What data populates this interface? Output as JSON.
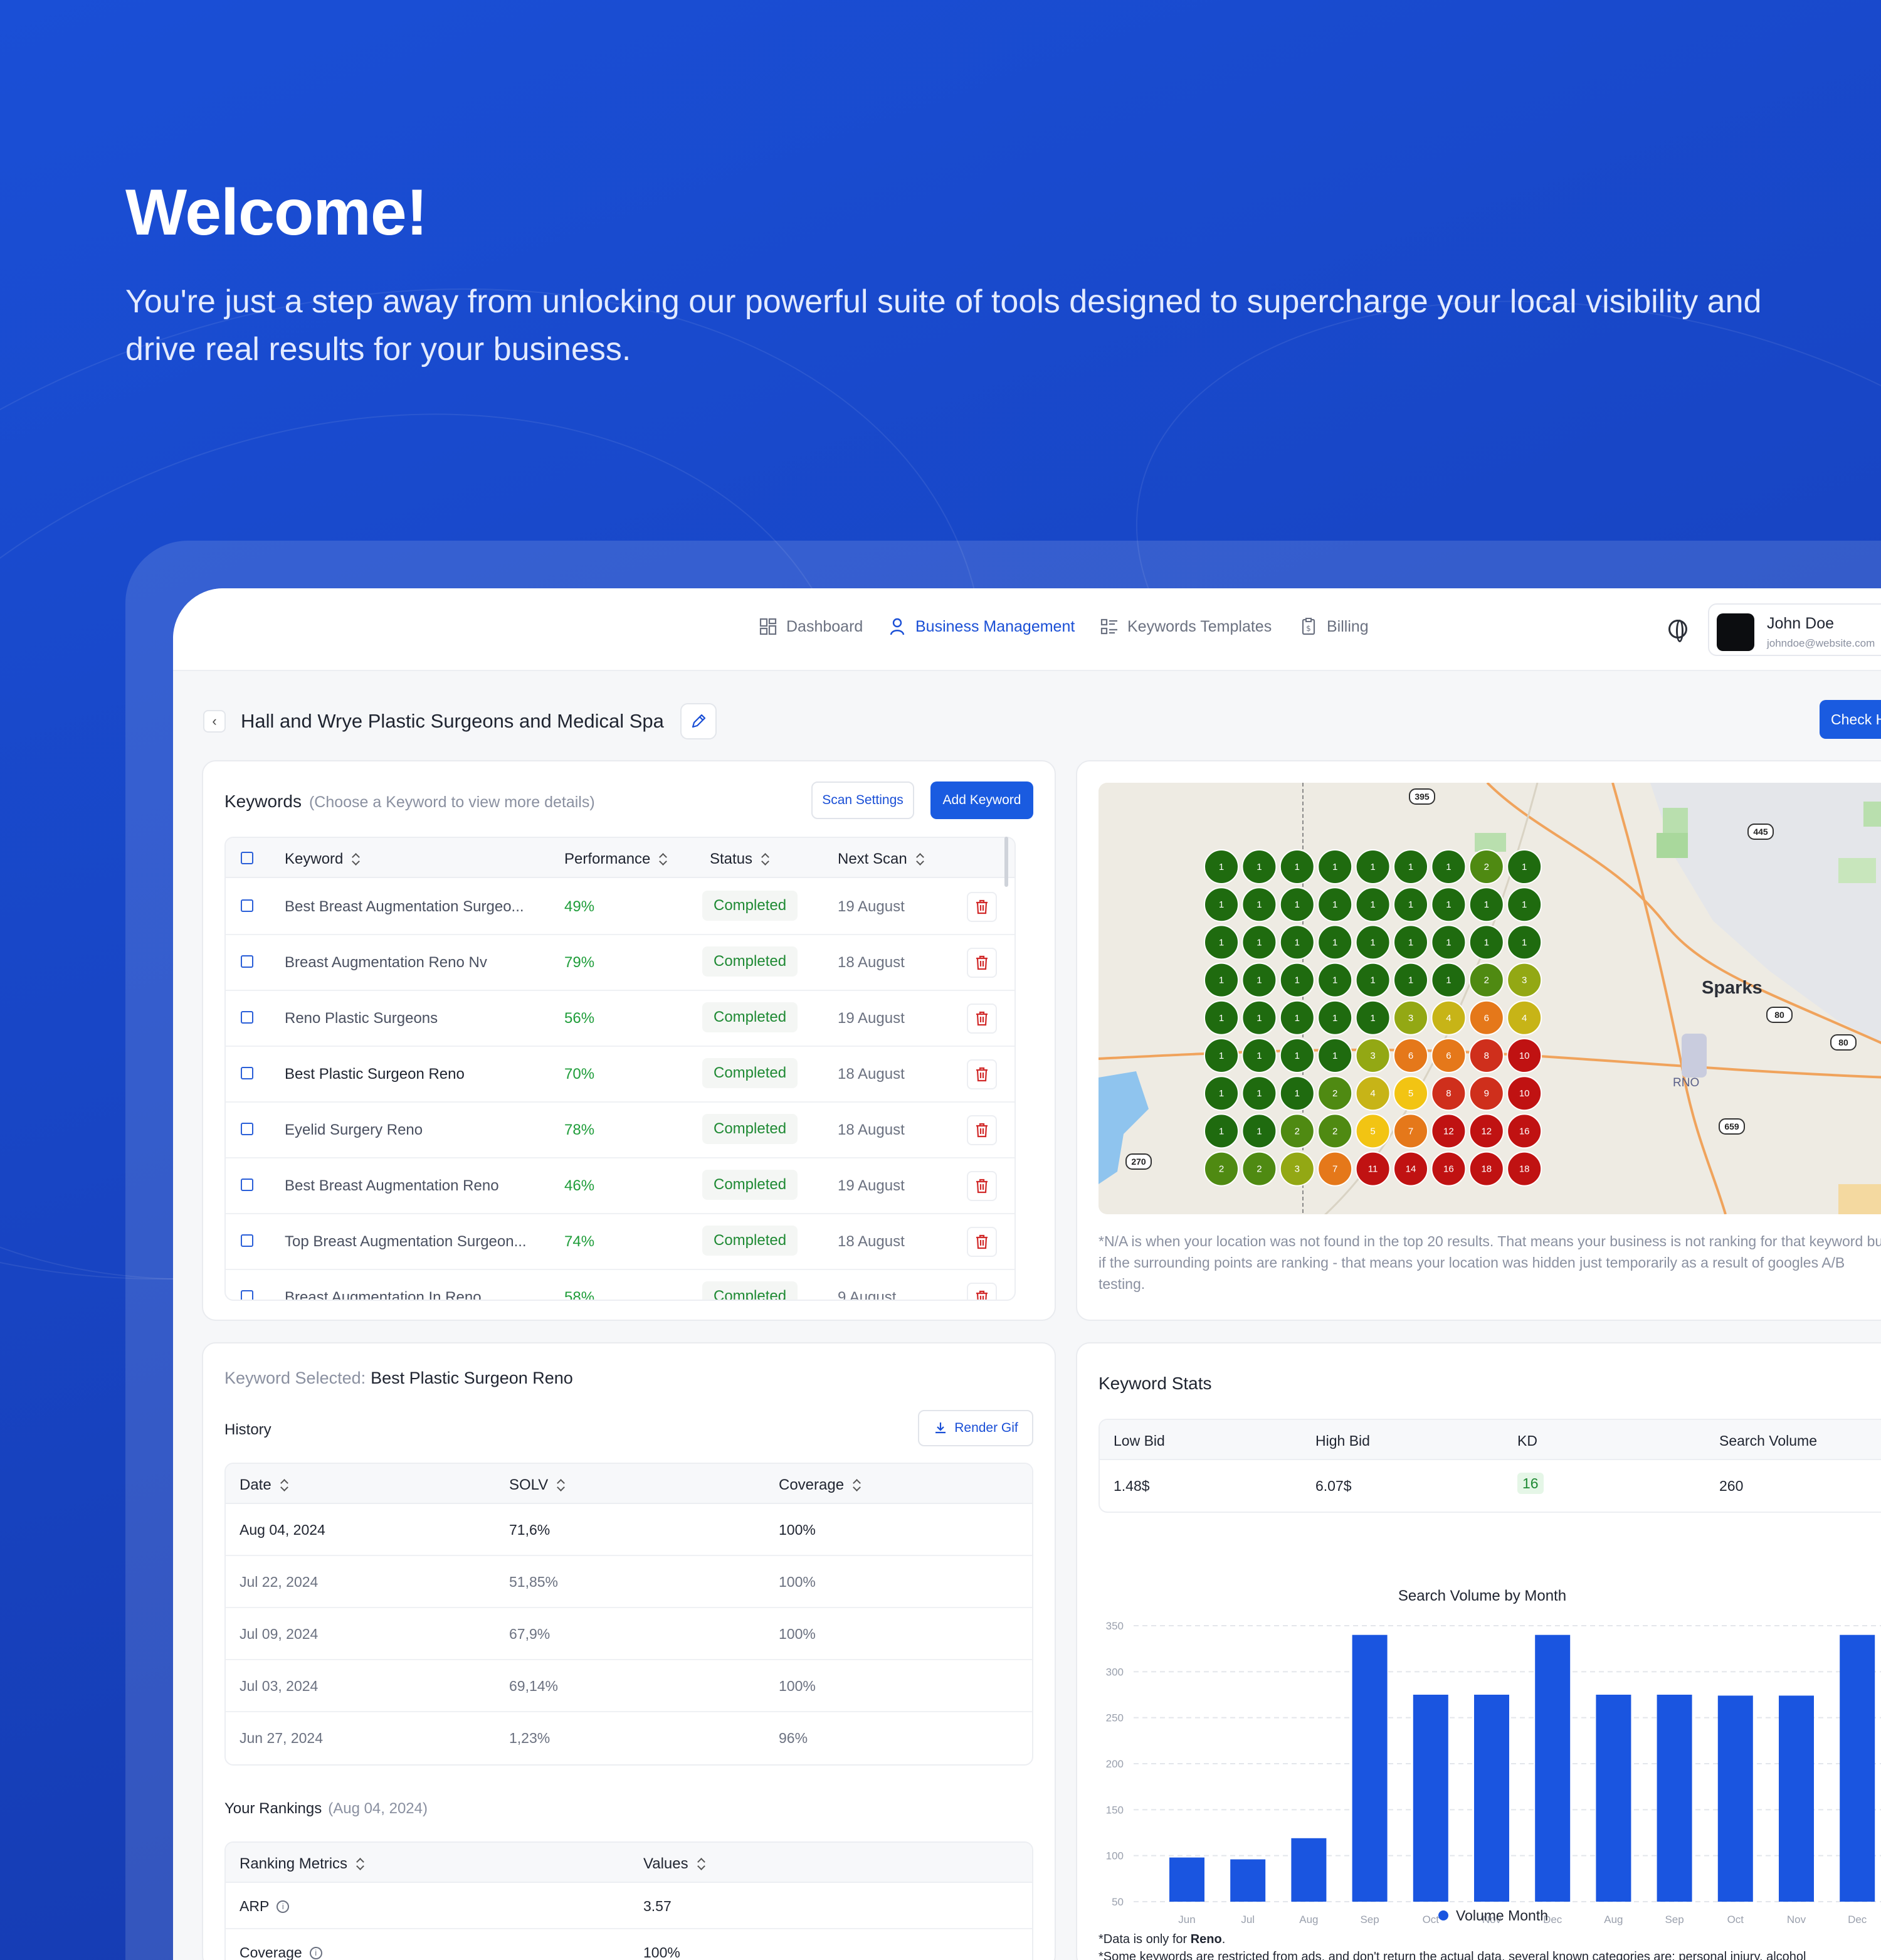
{
  "hero": {
    "title": "Welcome!",
    "subtitle": "You're just a step away from unlocking our powerful suite of tools designed to supercharge your local visibility and drive real results for your business."
  },
  "nav": {
    "items": [
      {
        "label": "Dashboard",
        "icon": "dashboard-icon"
      },
      {
        "label": "Business Management",
        "icon": "user-icon",
        "active": true
      },
      {
        "label": "Keywords Templates",
        "icon": "list-icon"
      },
      {
        "label": "Billing",
        "icon": "receipt-icon"
      }
    ],
    "user": {
      "name": "John Doe",
      "email": "johndoe@website.com"
    }
  },
  "business": {
    "title": "Hall and Wrye Plastic Surgeons and Medical Spa",
    "check_button": "Check H"
  },
  "keywords": {
    "title": "Keywords",
    "hint": "(Choose a Keyword to view more details)",
    "scan_settings": "Scan Settings",
    "add_keyword": "Add Keyword",
    "columns": [
      "Keyword",
      "Performance",
      "Status",
      "Next Scan"
    ],
    "rows": [
      {
        "keyword": "Best Breast Augmentation Surgeo...",
        "performance": "49%",
        "status": "Completed",
        "next_scan": "19 August"
      },
      {
        "keyword": "Breast Augmentation Reno Nv",
        "performance": "79%",
        "status": "Completed",
        "next_scan": "18 August"
      },
      {
        "keyword": "Reno Plastic Surgeons",
        "performance": "56%",
        "status": "Completed",
        "next_scan": "19 August"
      },
      {
        "keyword": "Best Plastic Surgeon Reno",
        "performance": "70%",
        "status": "Completed",
        "next_scan": "18 August",
        "selected": true
      },
      {
        "keyword": "Eyelid Surgery Reno",
        "performance": "78%",
        "status": "Completed",
        "next_scan": "18 August"
      },
      {
        "keyword": "Best Breast Augmentation Reno",
        "performance": "46%",
        "status": "Completed",
        "next_scan": "19 August"
      },
      {
        "keyword": "Top Breast Augmentation Surgeon...",
        "performance": "74%",
        "status": "Completed",
        "next_scan": "18 August"
      },
      {
        "keyword": "Breast Augmentation In Reno",
        "performance": "58%",
        "status": "Completed",
        "next_scan": "9 August"
      }
    ]
  },
  "map": {
    "city_label": "Sparks",
    "airport_label": "RNO",
    "road_labels": [
      "395",
      "445",
      "80",
      "80",
      "659",
      "270"
    ],
    "grid": [
      [
        1,
        1,
        1,
        1,
        1,
        1,
        1,
        2,
        1
      ],
      [
        1,
        1,
        1,
        1,
        1,
        1,
        1,
        1,
        1
      ],
      [
        1,
        1,
        1,
        1,
        1,
        1,
        1,
        1,
        1
      ],
      [
        1,
        1,
        1,
        1,
        1,
        1,
        1,
        2,
        3
      ],
      [
        1,
        1,
        1,
        1,
        1,
        3,
        4,
        6,
        4
      ],
      [
        1,
        1,
        1,
        1,
        3,
        6,
        6,
        8,
        10
      ],
      [
        1,
        1,
        1,
        2,
        4,
        5,
        8,
        9,
        10
      ],
      [
        1,
        1,
        2,
        2,
        5,
        7,
        12,
        12,
        16
      ],
      [
        2,
        2,
        3,
        7,
        11,
        14,
        16,
        18,
        18
      ]
    ],
    "note": "*N/A is when your location was not found in the top 20 results. That means your business is not ranking for that keyword but if the surrounding points are ranking - that means your location was hidden just temporarily as a result of googles A/B testing."
  },
  "selected": {
    "label": "Keyword Selected:",
    "keyword": "Best Plastic Surgeon Reno",
    "history_title": "History",
    "render_gif": "Render Gif",
    "history_columns": [
      "Date",
      "SOLV",
      "Coverage"
    ],
    "history": [
      {
        "date": "Aug 04, 2024",
        "solv": "71,6%",
        "coverage": "100%"
      },
      {
        "date": "Jul 22, 2024",
        "solv": "51,85%",
        "coverage": "100%"
      },
      {
        "date": "Jul 09, 2024",
        "solv": "67,9%",
        "coverage": "100%"
      },
      {
        "date": "Jul 03, 2024",
        "solv": "69,14%",
        "coverage": "100%"
      },
      {
        "date": "Jun 27, 2024",
        "solv": "1,23%",
        "coverage": "96%"
      }
    ],
    "rankings_title": "Your Rankings",
    "rankings_date": "(Aug 04, 2024)",
    "rankings_columns": [
      "Ranking Metrics",
      "Values"
    ],
    "rankings": [
      {
        "metric": "ARP",
        "value": "3.57"
      },
      {
        "metric": "Coverage",
        "value": "100%"
      }
    ]
  },
  "stats": {
    "title": "Keyword Stats",
    "columns": [
      "Low Bid",
      "High Bid",
      "KD",
      "Search Volume"
    ],
    "values": [
      "1.48$",
      "6.07$",
      "16",
      "260"
    ],
    "note_prefix": "*Data is only for ",
    "note_city": "Reno",
    "note_suffix": ".",
    "note2": "*Some keywords are restricted from ads, and don't return the actual data, several known categories are: personal injury, alcohol"
  },
  "chart_data": {
    "type": "bar",
    "title": "Search Volume by Month",
    "categories": [
      "Jun",
      "Jul",
      "Aug",
      "Sep",
      "Oct",
      "Nov",
      "Dec",
      "Aug",
      "Sep",
      "Oct",
      "Nov",
      "Dec"
    ],
    "series": [
      {
        "name": "Volume Month",
        "values": [
          98,
          96,
          119,
          340,
          275,
          275,
          340,
          275,
          275,
          274,
          274,
          340
        ]
      }
    ],
    "ylim": [
      50,
      350
    ],
    "yticks": [
      50,
      100,
      150,
      200,
      250,
      300,
      350
    ],
    "grid": true,
    "legend": "bottom",
    "color": "#1a55e0"
  }
}
